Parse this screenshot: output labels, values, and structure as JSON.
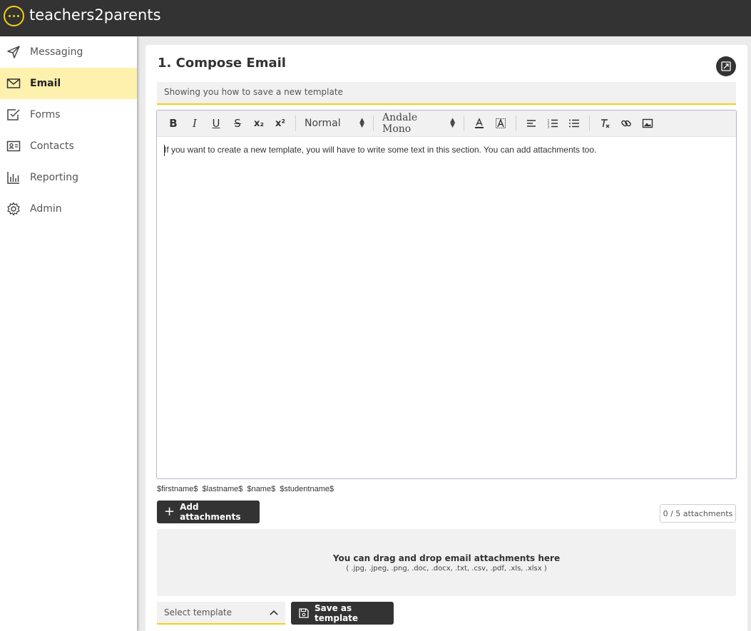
{
  "app": {
    "brand": "teachers2parents",
    "accent": "#f6cf0e"
  },
  "sidebar": {
    "items": [
      {
        "label": "Messaging",
        "icon": "send-icon",
        "active": false
      },
      {
        "label": "Email",
        "icon": "envelope-icon",
        "active": true
      },
      {
        "label": "Forms",
        "icon": "checkbox-icon",
        "active": false
      },
      {
        "label": "Contacts",
        "icon": "contact-card-icon",
        "active": false
      },
      {
        "label": "Reporting",
        "icon": "bar-chart-icon",
        "active": false
      },
      {
        "label": "Admin",
        "icon": "gear-icon",
        "active": false
      }
    ]
  },
  "compose": {
    "title": "1. Compose Email",
    "subject_value": "Showing you how to save a new template",
    "toolbar": {
      "bold": "B",
      "italic": "I",
      "underline": "U",
      "strike": "S",
      "subscript": "x₂",
      "superscript": "x²",
      "size_value": "Normal",
      "font_value": "Andale Mono"
    },
    "body_text": "If you want to create a new template, you will have to write some text in this section. You can add attachments too.",
    "variables": "$firstname$ $lastname$ $name$ $studentname$",
    "add_attachments_label": "Add attachments",
    "attachment_count": "0 / 5 attachments",
    "dropzone_title": "You can drag and drop email attachments here",
    "dropzone_types": "( .jpg, .jpeg, .png, .doc, .docx, .txt, .csv, .pdf, .xls, .xlsx )",
    "template_placeholder": "Select template",
    "save_template_label": "Save as template"
  }
}
